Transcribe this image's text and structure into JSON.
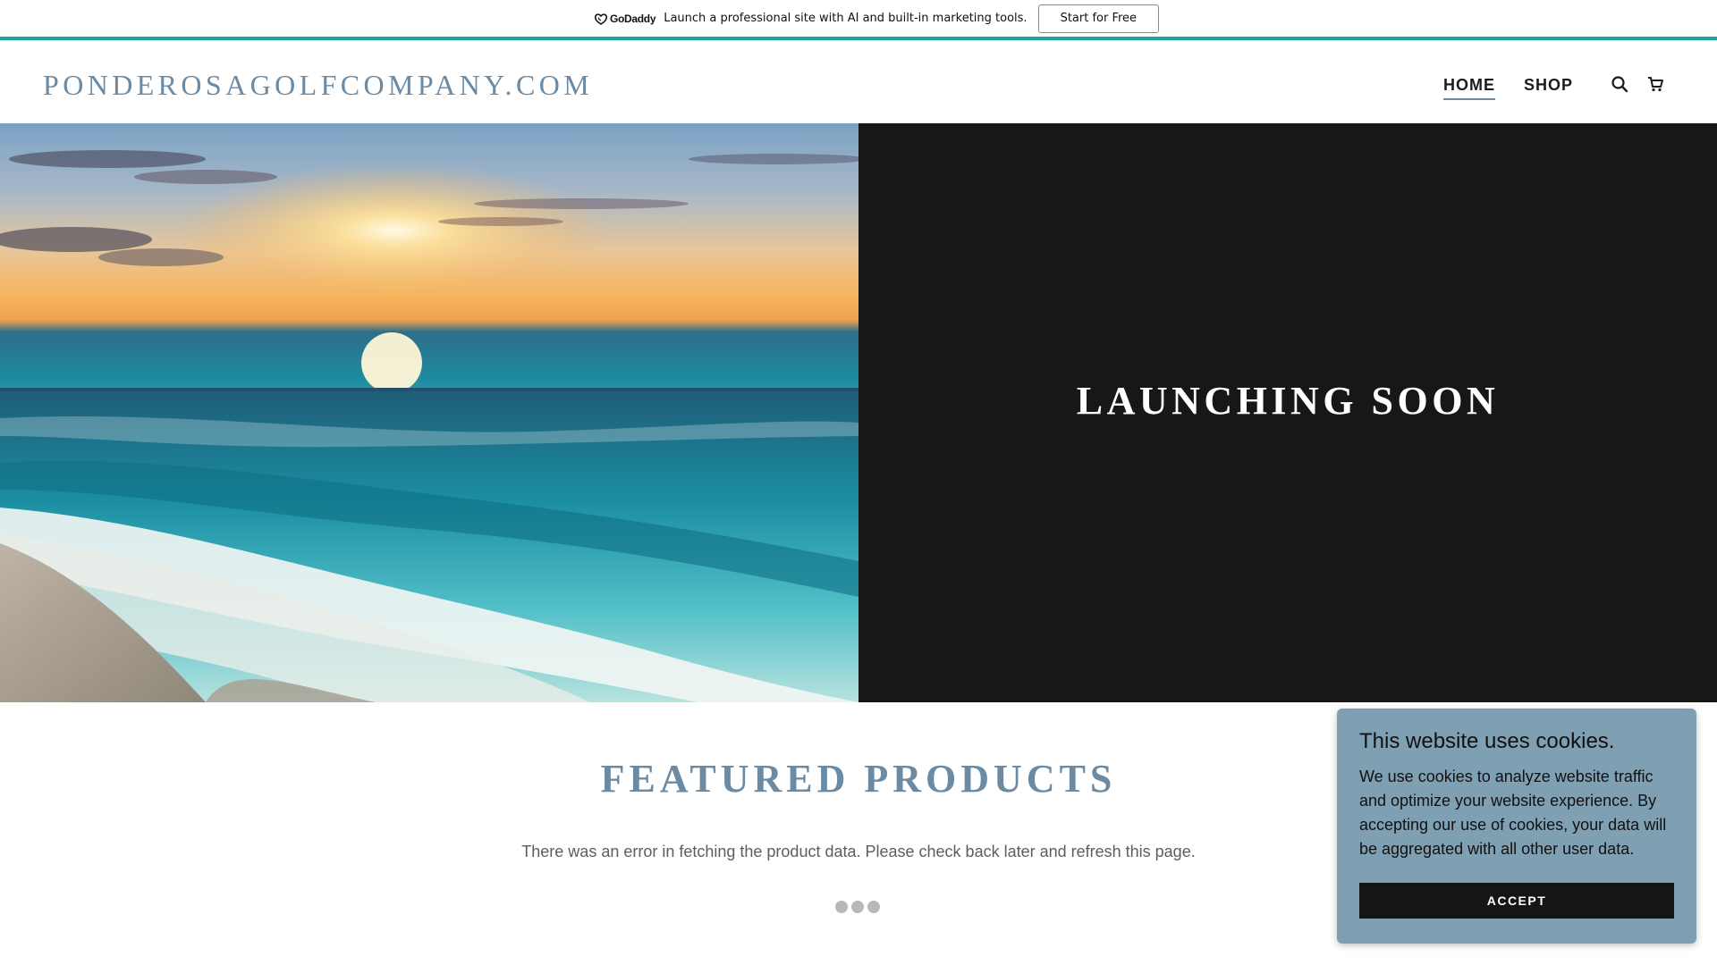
{
  "promo": {
    "brand": "GoDaddy",
    "text": "Launch a professional site with AI and built-in marketing tools.",
    "button_label": "Start for Free"
  },
  "header": {
    "logo": "PONDEROSAGOLFCOMPANY.COM",
    "nav": [
      {
        "label": "HOME",
        "active": true
      },
      {
        "label": "SHOP",
        "active": false
      }
    ],
    "icons": [
      "search-icon",
      "cart-icon"
    ]
  },
  "hero": {
    "image": "beach-sunset-waves",
    "title": "LAUNCHING SOON"
  },
  "featured": {
    "title": "FEATURED PRODUCTS",
    "message": "There was an error in fetching the product data. Please check back later and refresh this page."
  },
  "cookie": {
    "title": "This website uses cookies.",
    "text": "We use cookies to analyze website traffic and optimize your website experience. By accepting our use of cookies, your data will be aggregated with all other user data.",
    "button_label": "ACCEPT"
  },
  "colors": {
    "accent": "#6b8aa3",
    "promo_border": "#1ba5a3",
    "hero_panel": "#171717",
    "cookie_bg": "#7f9fb3"
  }
}
